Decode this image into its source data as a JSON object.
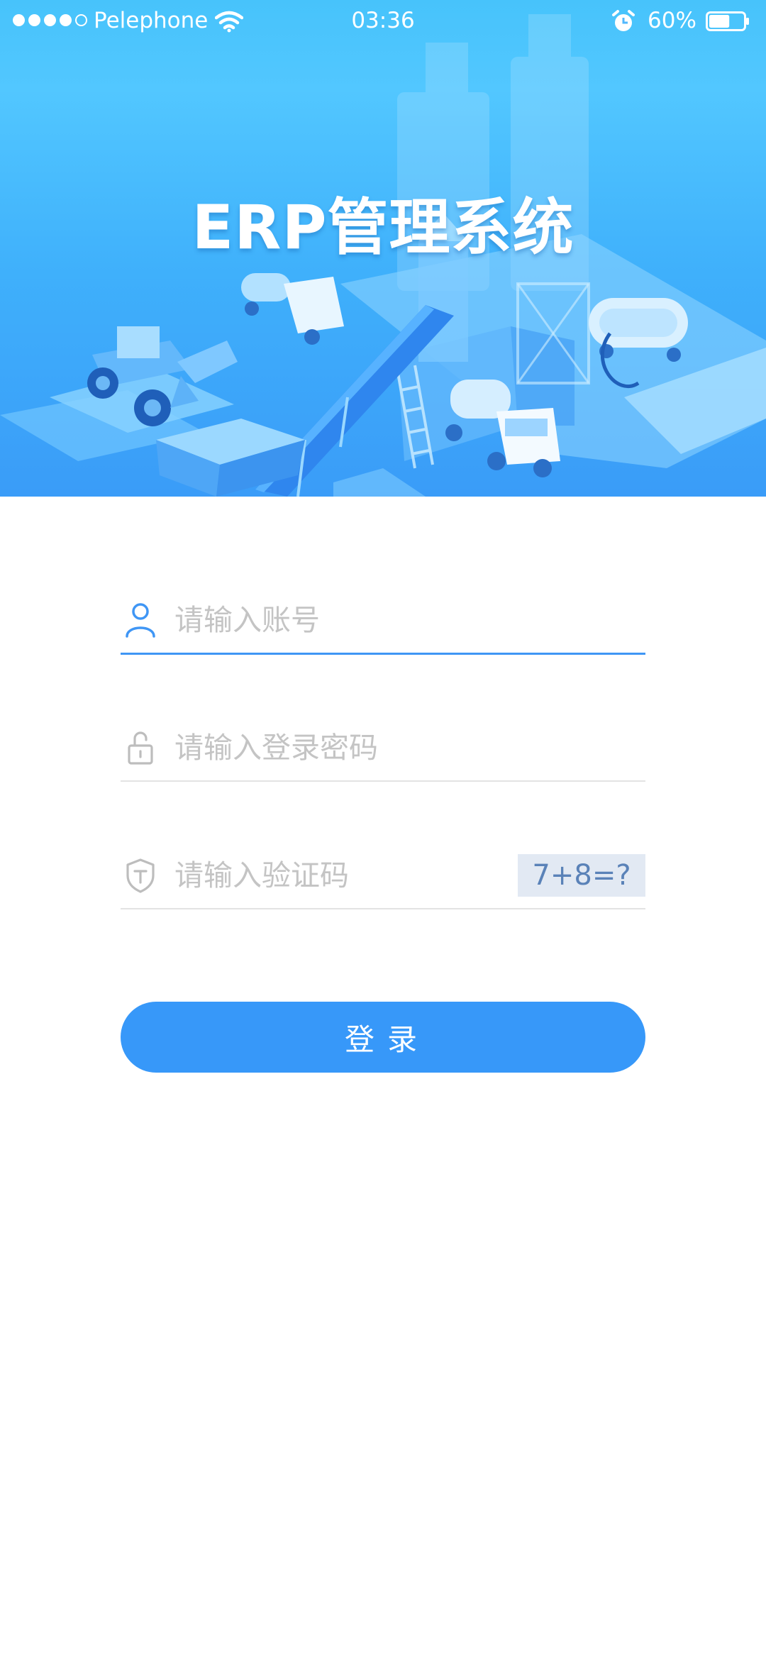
{
  "status_bar": {
    "carrier": "Pelephone",
    "time": "03:36",
    "battery_percent": "60%",
    "battery_level": 0.6,
    "signal_bars_filled": 4,
    "signal_bars_total": 5
  },
  "hero": {
    "title": "ERP管理系统"
  },
  "form": {
    "account_placeholder": "请输入账号",
    "password_placeholder": "请输入登录密码",
    "captcha_placeholder": "请输入验证码",
    "captcha_text": "7+8=?",
    "login_label": "登录"
  },
  "colors": {
    "primary": "#3798f9",
    "active_underline": "#3f96f5",
    "captcha_bg": "#e2e9f3",
    "captcha_text": "#5a82b8",
    "placeholder": "#c4c4c4"
  },
  "icons": {
    "account": "user-icon",
    "password": "lock-icon",
    "captcha": "shield-icon"
  }
}
